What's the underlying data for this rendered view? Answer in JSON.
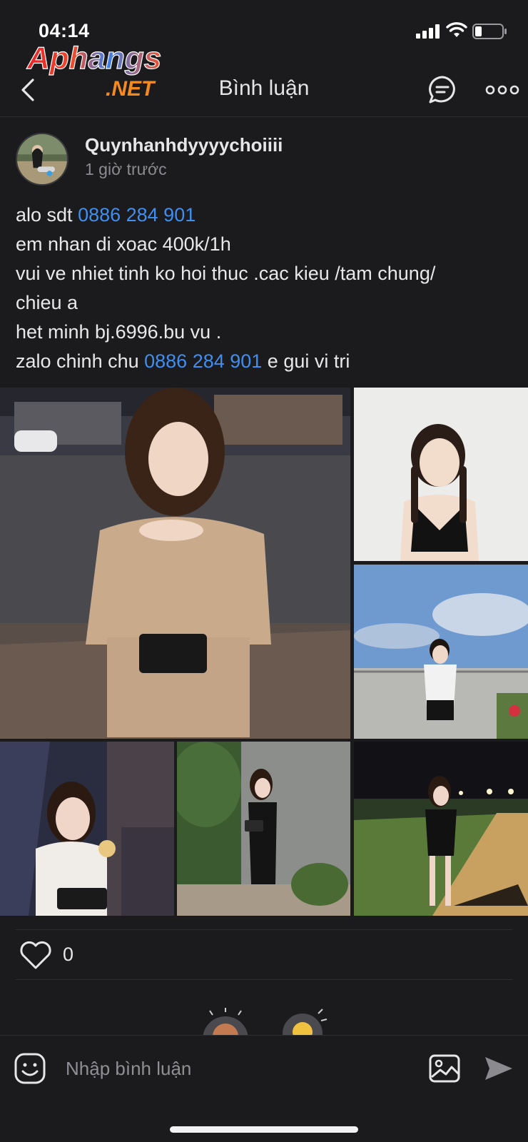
{
  "status_bar": {
    "time": "04:14"
  },
  "watermark": {
    "line1": "Aphangs",
    "line2": ".NET"
  },
  "header": {
    "title": "Bình luận"
  },
  "post": {
    "author": "Quynhanhdyyyychoiiii",
    "time": "1 giờ trước",
    "lines": {
      "l1_prefix": "alo sdt ",
      "phone1": "0886 284 901",
      "l2": "em nhan di xoac 400k/1h",
      "l3": "vui ve nhiet tinh ko hoi thuc .cac kieu /tam chung/",
      "l4": "chieu a",
      "l5": "het minh bj.6996.bu vu .",
      "l6_prefix": "zalo chinh chu ",
      "phone2": "0886 284 901",
      "l6_suffix": " e gui vi tri"
    },
    "likes": "0"
  },
  "comment_bar": {
    "placeholder": "Nhập bình luận"
  },
  "colors": {
    "background": "#1b1b1d",
    "link": "#3f8ef0",
    "text": "#e8e8ea",
    "muted": "#8b8b90"
  }
}
